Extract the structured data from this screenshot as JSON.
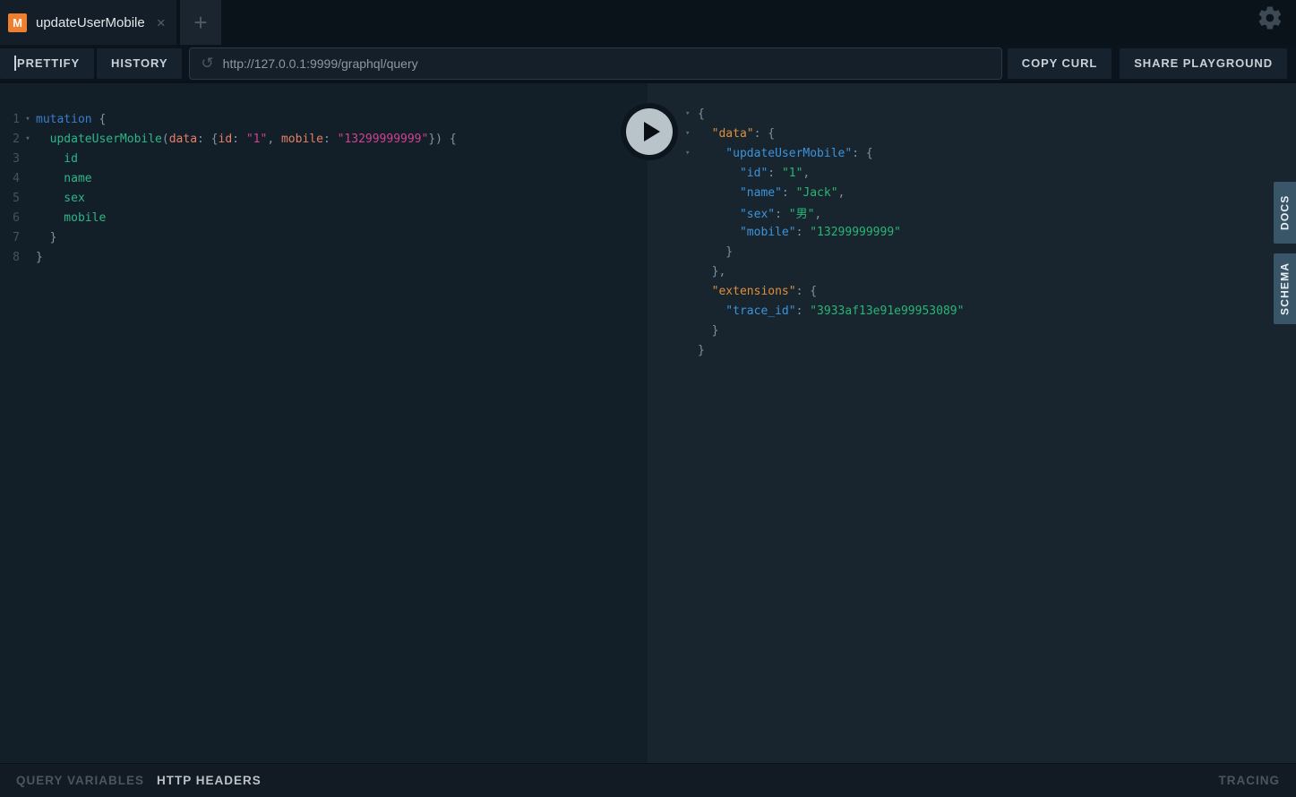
{
  "tab": {
    "badge": "M",
    "title": "updateUserMobile",
    "close_icon": "×",
    "plus_icon": "+"
  },
  "toolbar": {
    "prettify": "PRETTIFY",
    "history": "HISTORY",
    "url": "http://127.0.0.1:9999/graphql/query",
    "copy_curl": "COPY CURL",
    "share": "SHARE PLAYGROUND"
  },
  "icons": {
    "history_glyph": "↺",
    "fold_glyph": "▾",
    "settings": "gear-icon"
  },
  "colors": {
    "accent_badge": "#ed7f2f",
    "editor_bg": "#121f29",
    "result_bg": "#18252f",
    "side_tab_bg": "#395669"
  },
  "syntax_colors": {
    "keyword": "#397dc9",
    "field": "#2fb588",
    "argument": "#e77e65",
    "string": "#d2418e",
    "punctuation": "#8193a1",
    "result_key": "#3d93d9",
    "result_top_key": "#e08e3c",
    "result_string": "#29b573",
    "result_punctuation": "#7e909e"
  },
  "editor": {
    "lines": [
      {
        "num": "1",
        "fold": true,
        "tokens": [
          {
            "c": "keyword",
            "s": "mutation"
          },
          {
            "c": "punctuation",
            "s": " {"
          }
        ]
      },
      {
        "num": "2",
        "fold": true,
        "tokens": [
          {
            "c": "field",
            "s": "  updateUserMobile"
          },
          {
            "c": "punctuation",
            "s": "("
          },
          {
            "c": "argument",
            "s": "data"
          },
          {
            "c": "punctuation",
            "s": ": {"
          },
          {
            "c": "argument",
            "s": "id"
          },
          {
            "c": "punctuation",
            "s": ": "
          },
          {
            "c": "string",
            "s": "\"1\""
          },
          {
            "c": "punctuation",
            "s": ", "
          },
          {
            "c": "argument",
            "s": "mobile"
          },
          {
            "c": "punctuation",
            "s": ": "
          },
          {
            "c": "string",
            "s": "\"13299999999\""
          },
          {
            "c": "punctuation",
            "s": "}) {"
          }
        ]
      },
      {
        "num": "3",
        "fold": false,
        "tokens": [
          {
            "c": "field",
            "s": "    id"
          }
        ]
      },
      {
        "num": "4",
        "fold": false,
        "tokens": [
          {
            "c": "field",
            "s": "    name"
          }
        ]
      },
      {
        "num": "5",
        "fold": false,
        "tokens": [
          {
            "c": "field",
            "s": "    sex"
          }
        ]
      },
      {
        "num": "6",
        "fold": false,
        "tokens": [
          {
            "c": "field",
            "s": "    mobile"
          }
        ]
      },
      {
        "num": "7",
        "fold": false,
        "tokens": [
          {
            "c": "punctuation",
            "s": "  }"
          }
        ]
      },
      {
        "num": "8",
        "fold": false,
        "tokens": [
          {
            "c": "punctuation",
            "s": "}"
          }
        ]
      }
    ]
  },
  "result": {
    "lines": [
      {
        "fold": true,
        "tokens": [
          {
            "c": "result_punctuation",
            "s": "{"
          }
        ]
      },
      {
        "fold": true,
        "tokens": [
          {
            "c": "result_top_key",
            "s": "  \"data\""
          },
          {
            "c": "result_punctuation",
            "s": ": {"
          }
        ]
      },
      {
        "fold": true,
        "tokens": [
          {
            "c": "result_key",
            "s": "    \"updateUserMobile\""
          },
          {
            "c": "result_punctuation",
            "s": ": {"
          }
        ]
      },
      {
        "fold": false,
        "tokens": [
          {
            "c": "result_key",
            "s": "      \"id\""
          },
          {
            "c": "result_punctuation",
            "s": ": "
          },
          {
            "c": "result_string",
            "s": "\"1\""
          },
          {
            "c": "result_punctuation",
            "s": ","
          }
        ]
      },
      {
        "fold": false,
        "tokens": [
          {
            "c": "result_key",
            "s": "      \"name\""
          },
          {
            "c": "result_punctuation",
            "s": ": "
          },
          {
            "c": "result_string",
            "s": "\"Jack\""
          },
          {
            "c": "result_punctuation",
            "s": ","
          }
        ]
      },
      {
        "fold": false,
        "tokens": [
          {
            "c": "result_key",
            "s": "      \"sex\""
          },
          {
            "c": "result_punctuation",
            "s": ": "
          },
          {
            "c": "result_string",
            "s": "\"男\""
          },
          {
            "c": "result_punctuation",
            "s": ","
          }
        ]
      },
      {
        "fold": false,
        "tokens": [
          {
            "c": "result_key",
            "s": "      \"mobile\""
          },
          {
            "c": "result_punctuation",
            "s": ": "
          },
          {
            "c": "result_string",
            "s": "\"13299999999\""
          }
        ]
      },
      {
        "fold": false,
        "tokens": [
          {
            "c": "result_punctuation",
            "s": "    }"
          }
        ]
      },
      {
        "fold": false,
        "tokens": [
          {
            "c": "result_punctuation",
            "s": "  },"
          }
        ]
      },
      {
        "fold": false,
        "tokens": [
          {
            "c": "result_top_key",
            "s": "  \"extensions\""
          },
          {
            "c": "result_punctuation",
            "s": ": {"
          }
        ]
      },
      {
        "fold": false,
        "tokens": [
          {
            "c": "result_key",
            "s": "    \"trace_id\""
          },
          {
            "c": "result_punctuation",
            "s": ": "
          },
          {
            "c": "result_string",
            "s": "\"3933af13e91e99953089\""
          }
        ]
      },
      {
        "fold": false,
        "tokens": [
          {
            "c": "result_punctuation",
            "s": "  }"
          }
        ]
      },
      {
        "fold": false,
        "tokens": [
          {
            "c": "result_punctuation",
            "s": "}"
          }
        ]
      }
    ]
  },
  "side_tabs": [
    {
      "label": "DOCS"
    },
    {
      "label": "SCHEMA"
    }
  ],
  "bottombar": {
    "query_variables": "QUERY VARIABLES",
    "http_headers": "HTTP HEADERS",
    "tracing": "TRACING"
  }
}
